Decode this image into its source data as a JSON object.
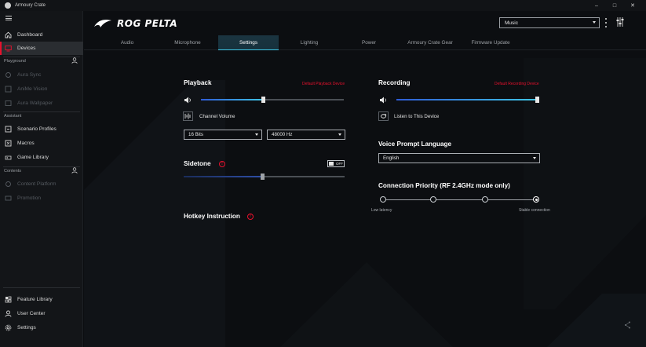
{
  "window": {
    "title": "Armoury Crate"
  },
  "sidebar": {
    "items_top": [
      {
        "label": "Dashboard",
        "icon": "home-icon",
        "active": false,
        "disabled": false
      },
      {
        "label": "Devices",
        "icon": "devices-icon",
        "active": true,
        "disabled": false
      }
    ],
    "playground_label": "Playground",
    "playground_items": [
      {
        "label": "Aura Sync",
        "icon": "aura-sync-icon",
        "disabled": true
      },
      {
        "label": "AniMe Vision",
        "icon": "anime-vision-icon",
        "disabled": true
      },
      {
        "label": "Aura Wallpaper",
        "icon": "aura-wallpaper-icon",
        "disabled": true
      }
    ],
    "assistant_label": "Assistant",
    "assistant_items": [
      {
        "label": "Scenario Profiles",
        "icon": "scenario-profiles-icon"
      },
      {
        "label": "Macros",
        "icon": "macros-icon"
      },
      {
        "label": "Game Library",
        "icon": "game-library-icon"
      }
    ],
    "contents_label": "Contents",
    "contents_items": [
      {
        "label": "Content Platform",
        "icon": "content-platform-icon",
        "disabled": true
      },
      {
        "label": "Promotion",
        "icon": "promotion-icon",
        "disabled": true
      }
    ],
    "bottom_items": [
      {
        "label": "Feature Library",
        "icon": "feature-library-icon"
      },
      {
        "label": "User Center",
        "icon": "user-center-icon"
      },
      {
        "label": "Settings",
        "icon": "settings-gear-icon"
      }
    ]
  },
  "header": {
    "brand": "ROG PELTA",
    "profile_value": "Music",
    "tabs": [
      "Audio",
      "Microphone",
      "Settings",
      "Lighting",
      "Power",
      "Armoury Crate Gear",
      "Firmware Update"
    ],
    "active_tab": "Settings"
  },
  "playback": {
    "title": "Playback",
    "default_link": "Default Playback Device",
    "volume_level": 0.45,
    "channel_volume_label": "Channel Volume",
    "bits_value": "16 Bits",
    "rate_value": "48000 Hz"
  },
  "sidetone": {
    "title": "Sidetone",
    "toggle_label": "OFF",
    "level": 0.5
  },
  "hotkey": {
    "title": "Hotkey Instruction"
  },
  "recording": {
    "title": "Recording",
    "default_link": "Default Recording Device",
    "volume_level": 1.0,
    "listen_label": "Listen to This Device"
  },
  "voice_prompt": {
    "title": "Voice Prompt Language",
    "value": "English"
  },
  "connection": {
    "title": "Connection Priority (RF 2.4GHz mode only)",
    "low_label": "Low latency",
    "high_label": "Stable connection",
    "steps": 4,
    "selected_step": 4
  },
  "colors": {
    "accent_red": "#e8112d",
    "accent_cyan": "#3fc7e6",
    "accent_blue": "#2f5cd6"
  }
}
